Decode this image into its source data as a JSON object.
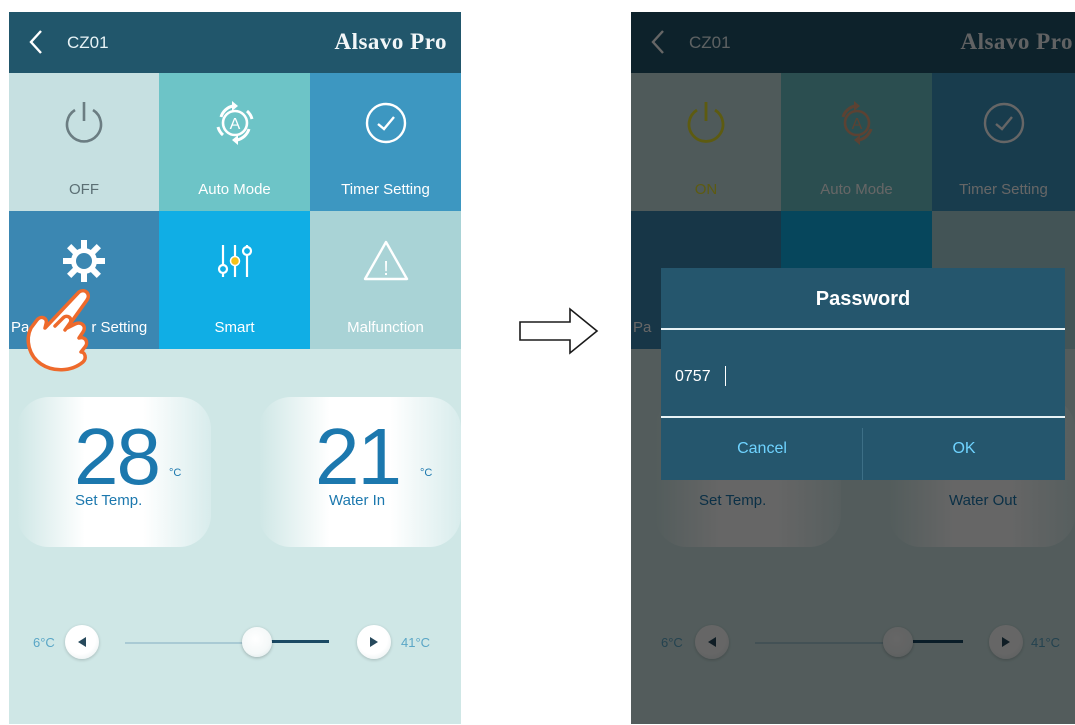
{
  "left": {
    "header": {
      "title": "CZ01",
      "brand": "Alsavo Pro"
    },
    "tiles": [
      {
        "label": "OFF",
        "icon": "power-icon"
      },
      {
        "label": "Auto Mode",
        "icon": "auto-mode-icon"
      },
      {
        "label": "Timer Setting",
        "icon": "clock-icon"
      },
      {
        "label": "Parameter Setting",
        "visible_label_parts": [
          "Pa",
          "r Setting"
        ],
        "icon": "gear-icon"
      },
      {
        "label": "Smart",
        "icon": "sliders-icon"
      },
      {
        "label": "Malfunction",
        "icon": "warning-icon"
      }
    ],
    "temps": {
      "set": {
        "value": "28",
        "unit": "°C",
        "label": "Set Temp."
      },
      "water": {
        "value": "21",
        "unit": "°C",
        "label": "Water In"
      }
    },
    "slider": {
      "min_label": "6°C",
      "max_label": "41°C",
      "value_fraction": 0.62
    },
    "gesture": "tap-hand-icon"
  },
  "right": {
    "header": {
      "title": "CZ01",
      "brand": "Alsavo Pro"
    },
    "tiles": [
      {
        "label": "ON",
        "icon": "power-icon"
      },
      {
        "label": "Auto Mode",
        "icon": "auto-mode-icon"
      },
      {
        "label": "Timer Setting",
        "icon": "clock-icon"
      }
    ],
    "partial_label": "Pa",
    "background_labels": {
      "set": "Set Temp.",
      "water": "Water Out"
    },
    "slider": {
      "min_label": "6°C",
      "max_label": "41°C",
      "value_fraction": 0.64
    },
    "dialog": {
      "title": "Password",
      "input_value": "0757",
      "cancel": "Cancel",
      "ok": "OK"
    }
  },
  "transition_arrow": "right-arrow-icon",
  "colors": {
    "header": "#21566b",
    "accent_blue": "#1c78ae",
    "dialog": "#25566d",
    "dialog_button_text": "#6fd3ff",
    "on_yellow": "#c9c41a"
  }
}
